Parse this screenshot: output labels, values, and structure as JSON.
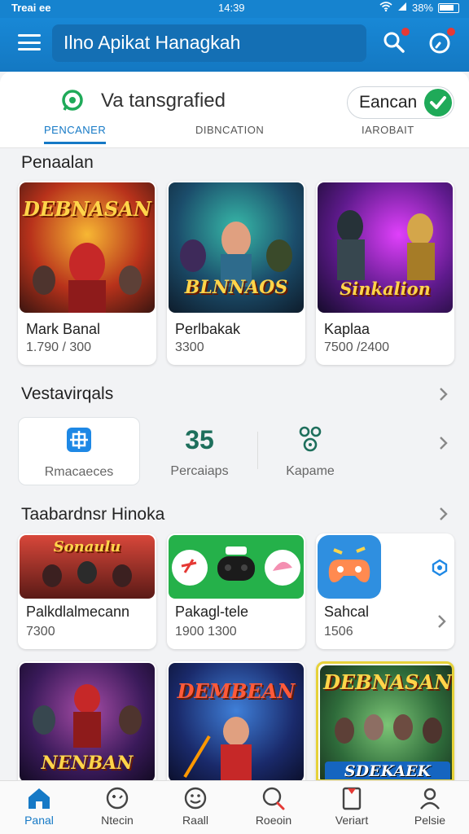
{
  "status_bar": {
    "left_text": "Treai ee",
    "time": "14:39",
    "battery": "38%"
  },
  "app_bar": {
    "title": "Ilno Apikat Hanagkah"
  },
  "status_row": {
    "text": "Va tansgrafied",
    "toggle_label": "Eancan"
  },
  "tabs": [
    {
      "label": "PENCANER",
      "active": true
    },
    {
      "label": "DIBNCATION",
      "active": false
    },
    {
      "label": "IAROBAIT",
      "active": false
    }
  ],
  "section1": {
    "title": "Penaalan",
    "games": [
      {
        "name": "Mark Banal",
        "price": "1.790 / 300",
        "art_text": "DEBNASAN"
      },
      {
        "name": "Perlbakak",
        "price": "3300",
        "art_text": "BLNNAOS"
      },
      {
        "name": "Kaplaa",
        "price": "7500 /2400",
        "art_text": "Sinkalion"
      }
    ]
  },
  "section2": {
    "title": "Vestavirqals",
    "stats": [
      {
        "value": "",
        "label": "Rmacaeces"
      },
      {
        "value": "35",
        "label": "Percaiaps"
      },
      {
        "value": "",
        "label": "Kapame"
      }
    ]
  },
  "section3": {
    "title": "Taabardnsr Hinoka",
    "games": [
      {
        "name": "Palkdlalmecann",
        "price": "7300",
        "art_text": "Sonaulu"
      },
      {
        "name": "Pakagl-tele",
        "price": "1900 1300",
        "art_text": ""
      },
      {
        "name": "Sahcal",
        "price": "1506",
        "art_text": ""
      }
    ]
  },
  "section4": {
    "games": [
      {
        "art_text": "NENBAN"
      },
      {
        "art_text": "DEMBEAN"
      },
      {
        "art_text": "SDEKAEK"
      }
    ]
  },
  "bottom_nav": [
    {
      "label": "Panal",
      "active": true
    },
    {
      "label": "Ntecin",
      "active": false
    },
    {
      "label": "Raall",
      "active": false
    },
    {
      "label": "Roeoin",
      "active": false
    },
    {
      "label": "Veriart",
      "active": false
    },
    {
      "label": "Pelsie",
      "active": false
    }
  ],
  "colors": {
    "primary": "#1579c6",
    "accent_green": "#1faa59",
    "notification": "#e53935"
  }
}
